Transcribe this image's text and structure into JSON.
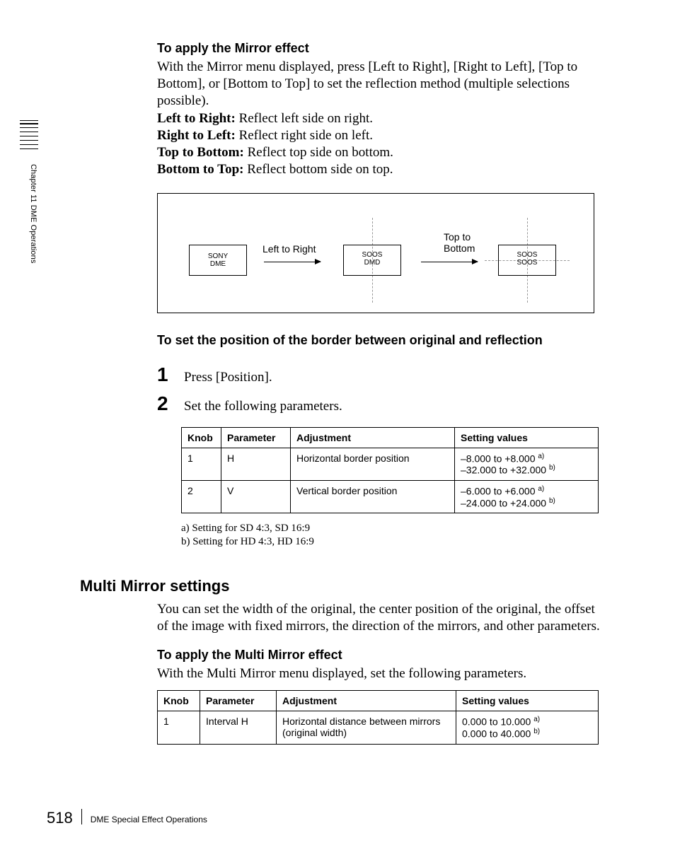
{
  "side_label": "Chapter 11  DME Operations",
  "mirror": {
    "heading": "To apply the Mirror effect",
    "intro": "With the Mirror menu displayed, press [Left to Right], [Right to Left], [Top to Bottom], or [Bottom to Top] to set the reflection method (multiple selections possible).",
    "defs": [
      {
        "term": "Left to Right:",
        "desc": " Reflect left side on right."
      },
      {
        "term": "Right to Left:",
        "desc": " Reflect right side on left."
      },
      {
        "term": "Top to Bottom:",
        "desc": " Reflect top side on bottom."
      },
      {
        "term": "Bottom to Top:",
        "desc": " Reflect bottom side on top."
      }
    ]
  },
  "figure": {
    "box1a": "SONY",
    "box1b": "DME",
    "label1": "Left to Right",
    "box2a": "SOOS",
    "box2b": "DMD",
    "label2a": "Top to",
    "label2b": "Bottom",
    "box3a": "SOOS",
    "box3b": "SOOS"
  },
  "border_pos": {
    "heading": "To set the position of the border between original and reflection",
    "steps": [
      {
        "n": "1",
        "text": "Press [Position]."
      },
      {
        "n": "2",
        "text": "Set the following parameters."
      }
    ],
    "table": {
      "headers": [
        "Knob",
        "Parameter",
        "Adjustment",
        "Setting values"
      ],
      "rows": [
        {
          "knob": "1",
          "param": "H",
          "adj": "Horizontal border position",
          "val1": "–8.000 to +8.000 ",
          "sup1": "a)",
          "val2": "–32.000 to +32.000 ",
          "sup2": "b)"
        },
        {
          "knob": "2",
          "param": "V",
          "adj": "Vertical border position",
          "val1": "–6.000 to +6.000 ",
          "sup1": "a)",
          "val2": "–24.000 to +24.000 ",
          "sup2": "b)"
        }
      ]
    },
    "footnotes": [
      "a) Setting for SD 4:3, SD 16:9",
      "b) Setting for HD 4:3, HD 16:9"
    ]
  },
  "multi_mirror": {
    "heading": "Multi Mirror settings",
    "intro": "You can set the width of the original, the center position of the original, the offset of the image with fixed mirrors, the direction of the mirrors, and other parameters.",
    "sub_heading": "To apply the Multi Mirror effect",
    "sub_intro": "With the Multi Mirror menu displayed, set the following parameters.",
    "table": {
      "headers": [
        "Knob",
        "Parameter",
        "Adjustment",
        "Setting values"
      ],
      "rows": [
        {
          "knob": "1",
          "param": "Interval H",
          "adj": "Horizontal distance between mirrors (original width)",
          "val1": "0.000 to 10.000 ",
          "sup1": "a)",
          "val2": "0.000 to 40.000 ",
          "sup2": "b)"
        }
      ]
    }
  },
  "footer": {
    "page": "518",
    "title": "DME Special Effect Operations"
  }
}
